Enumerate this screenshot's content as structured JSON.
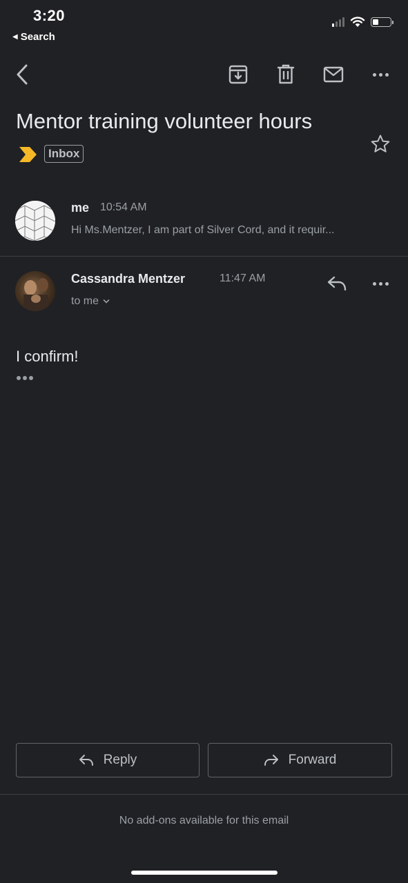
{
  "status_bar": {
    "time": "3:20",
    "back_app_label": "Search"
  },
  "toolbar": {
    "icons": [
      "back-arrow-icon",
      "archive-icon",
      "trash-icon",
      "mark-unread-icon",
      "more-icon"
    ]
  },
  "email": {
    "subject": "Mentor training volunteer hours",
    "label": "Inbox"
  },
  "messages": [
    {
      "sender": "me",
      "time": "10:54 AM",
      "snippet": "Hi Ms.Mentzer, I am part of Silver Cord, and it requir..."
    },
    {
      "sender": "Cassandra Mentzer",
      "time": "11:47 AM",
      "recipient": "to me",
      "body": "I confirm!"
    }
  ],
  "actions": {
    "reply_label": "Reply",
    "forward_label": "Forward"
  },
  "addons_text": "No add-ons available for this email",
  "colors": {
    "background": "#202124",
    "importance_marker": "#f6b826",
    "text_primary": "#e8eaed",
    "text_secondary": "#9aa0a6"
  }
}
